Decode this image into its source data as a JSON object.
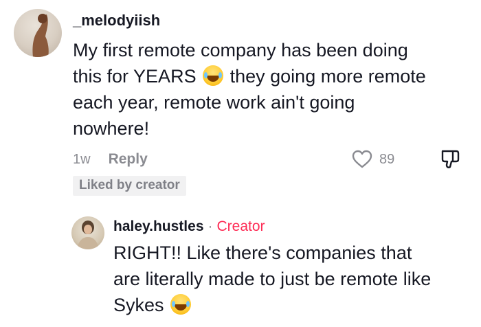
{
  "comment": {
    "username": "_melodyiish",
    "text_part1": "My first remote company has been doing this for YEARS",
    "text_part2": "they going more remote each year, remote work ain't going nowhere!",
    "emoji_name": "face-with-tears-of-joy",
    "time": "1w",
    "reply_label": "Reply",
    "likes": "89",
    "liked_badge": "Liked by creator"
  },
  "reply": {
    "username": "haley.hustles",
    "separator": "·",
    "badge": "Creator",
    "text": "RIGHT!! Like there's companies that are literally made to just be remote like Sykes",
    "emoji_name": "face-with-tears-of-joy"
  },
  "colors": {
    "text": "#161823",
    "secondary": "#8a8b91",
    "creator_badge": "#fe2c55",
    "badge_bg": "#f1f1f2"
  },
  "icons": [
    "heart-outline-icon",
    "dislike-icon"
  ]
}
